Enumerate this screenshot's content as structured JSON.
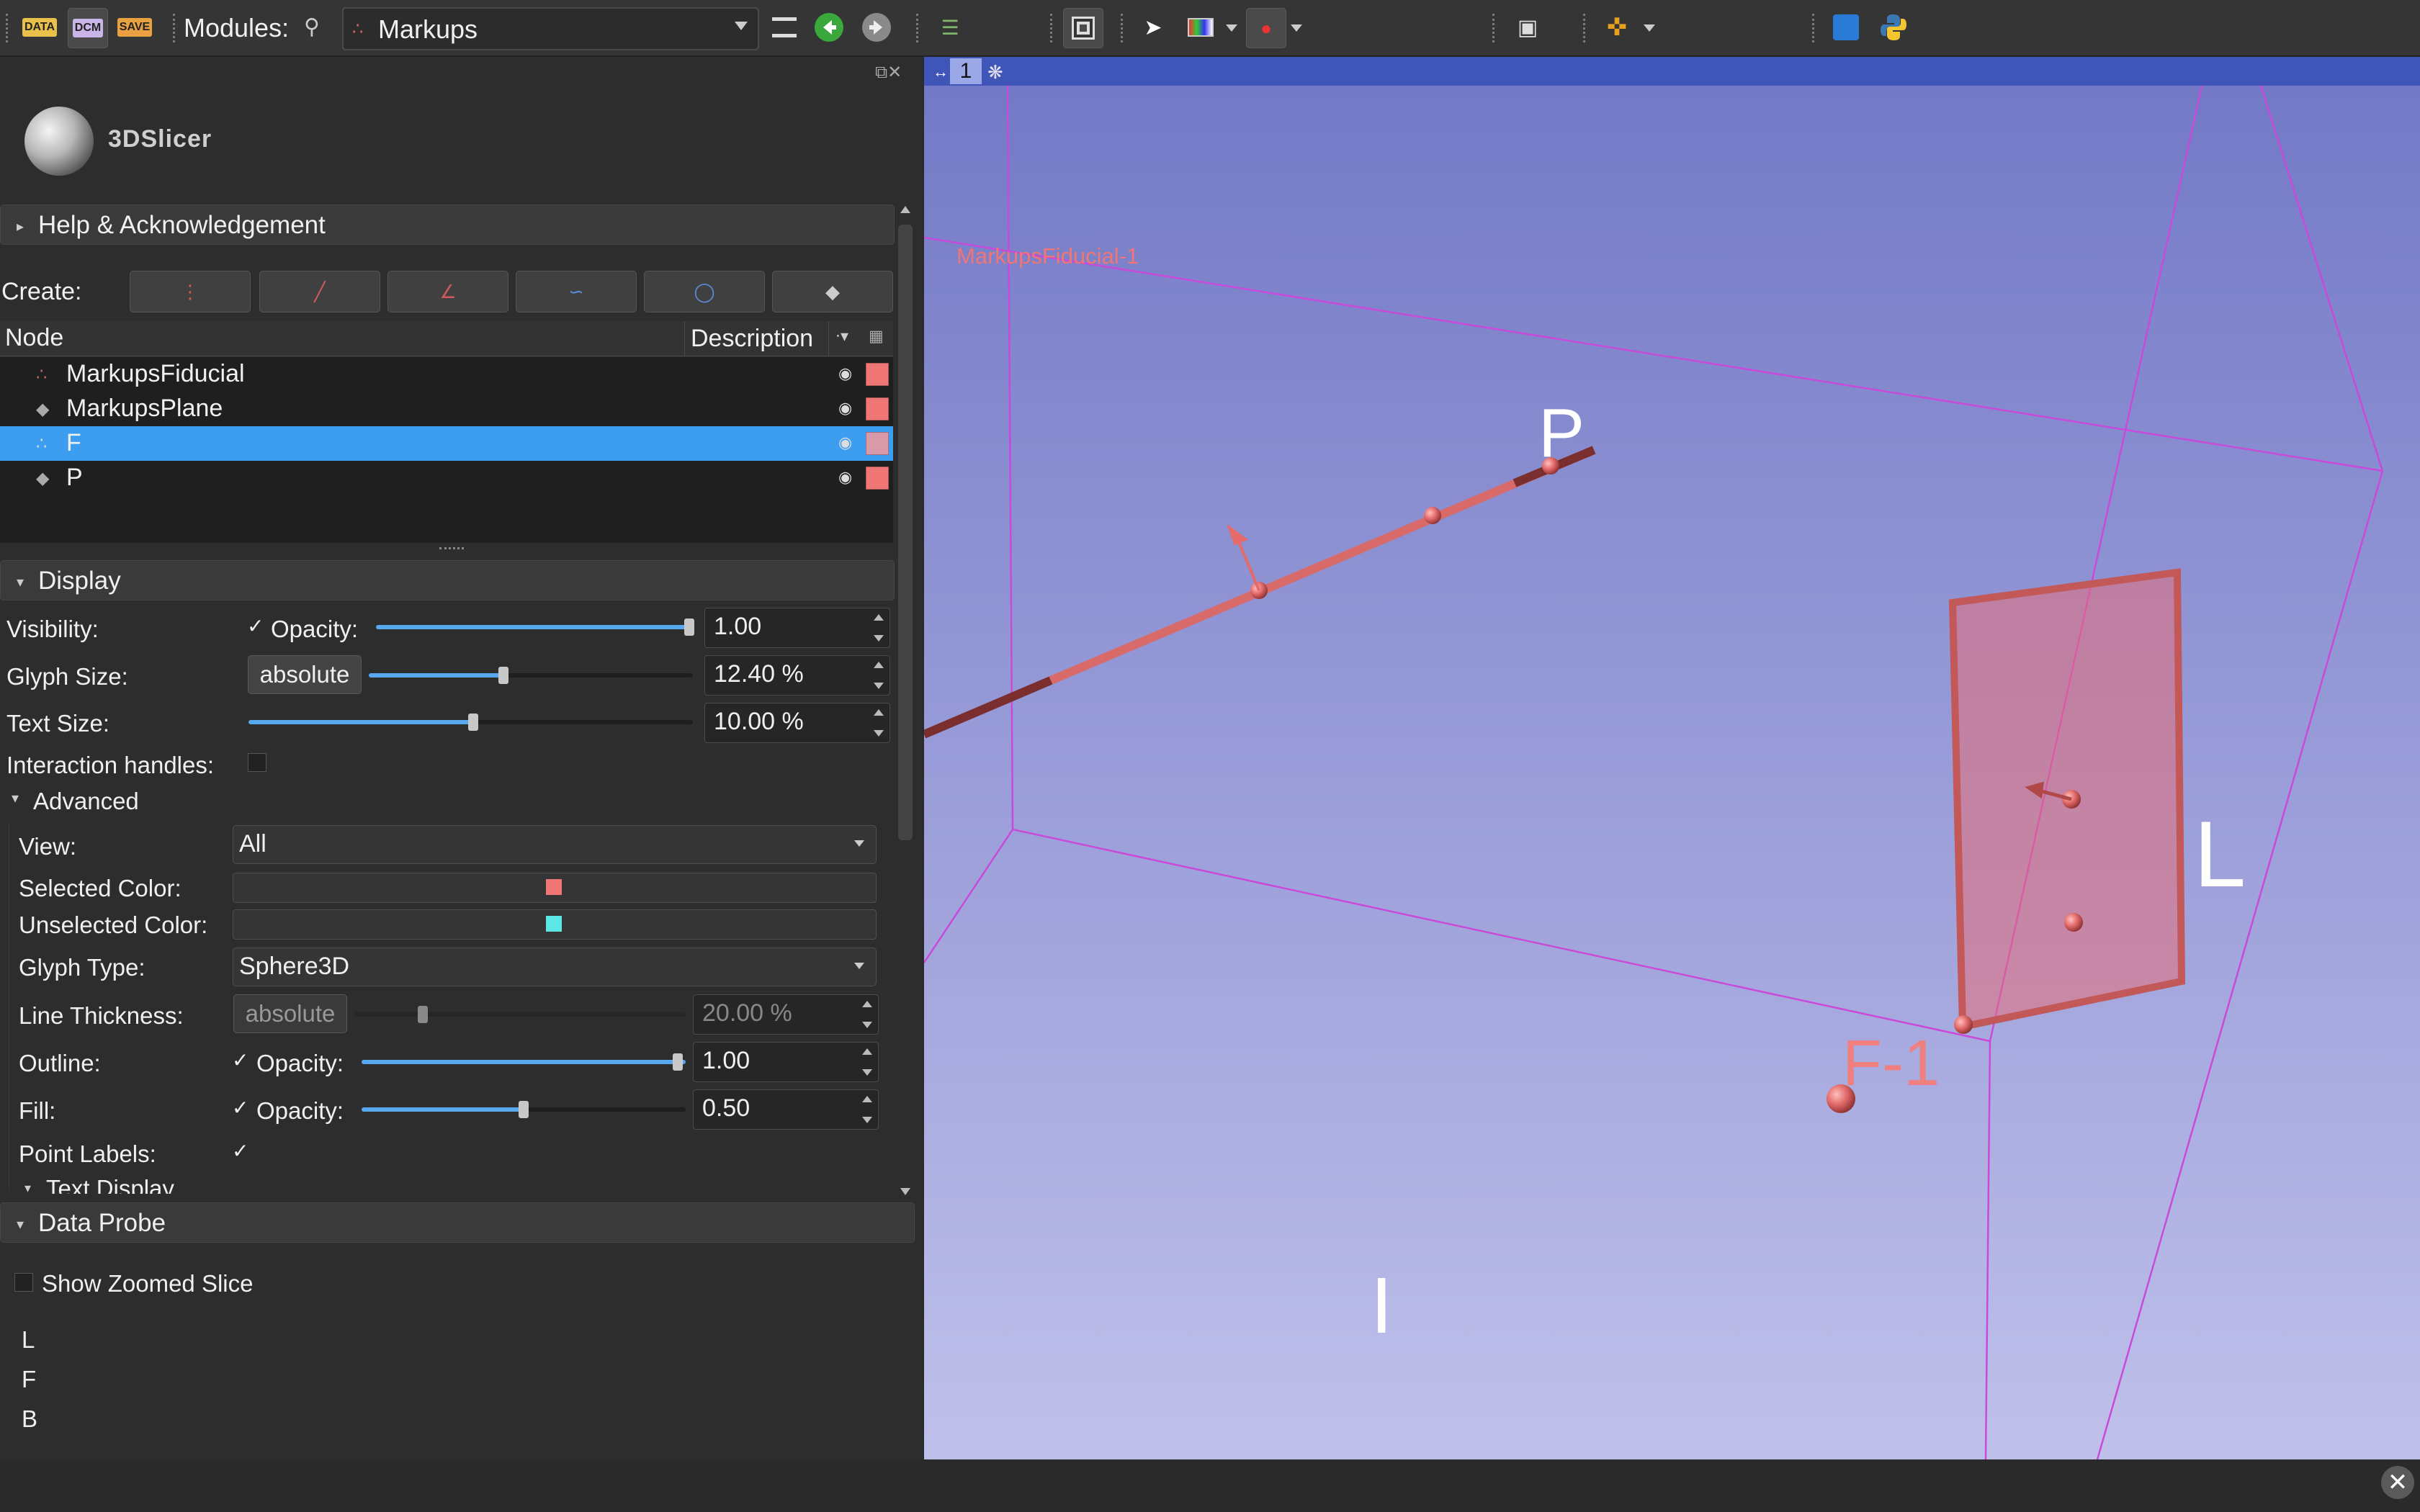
{
  "toolbar": {
    "data_label": "DATA",
    "dcm_label": "DCM",
    "save_label": "SAVE",
    "modules_label": "Modules:",
    "module_selected": "Markups"
  },
  "panel": {
    "logo_text": "3DSlicer",
    "help_label": "Help & Acknowledgement",
    "create_label": "Create:",
    "tree": {
      "col_node": "Node",
      "col_description": "Description",
      "rows": [
        {
          "name": "MarkupsFiducial"
        },
        {
          "name": "MarkupsPlane"
        },
        {
          "name": "F"
        },
        {
          "name": "P"
        }
      ]
    },
    "display": {
      "header": "Display",
      "visibility_label": "Visibility:",
      "opacity_label": "Opacity:",
      "opacity_value": "1.00",
      "glyph_size_label": "Glyph Size:",
      "glyph_size_mode": "absolute",
      "glyph_size_value": "12.40 %",
      "text_size_label": "Text Size:",
      "text_size_value": "10.00 %",
      "interaction_label": "Interaction handles:",
      "advanced_label": "Advanced",
      "view_label": "View:",
      "view_value": "All",
      "selected_color_label": "Selected Color:",
      "unselected_color_label": "Unselected Color:",
      "glyph_type_label": "Glyph Type:",
      "glyph_type_value": "Sphere3D",
      "line_thickness_label": "Line Thickness:",
      "line_thickness_mode": "absolute",
      "line_thickness_value": "20.00 %",
      "outline_label": "Outline:",
      "outline_opacity_label": "Opacity:",
      "outline_opacity_value": "1.00",
      "fill_label": "Fill:",
      "fill_opacity_label": "Opacity:",
      "fill_opacity_value": "0.50",
      "point_labels_label": "Point Labels:",
      "text_display_label": "Text Display"
    },
    "data_probe": {
      "header": "Data Probe",
      "show_zoomed_label": "Show Zoomed Slice",
      "l_label": "L",
      "f_label": "F",
      "b_label": "B"
    }
  },
  "view": {
    "view_number": "1",
    "fiducial_caption": "MarkupsFiducial-1",
    "label_p": "P",
    "label_l": "L",
    "label_i": "I",
    "label_f1": "F-1"
  },
  "colors": {
    "selected": "#f07575",
    "unselected": "#5ce6e6",
    "accent": "#3d9df0",
    "markup": "#d86a6a"
  }
}
